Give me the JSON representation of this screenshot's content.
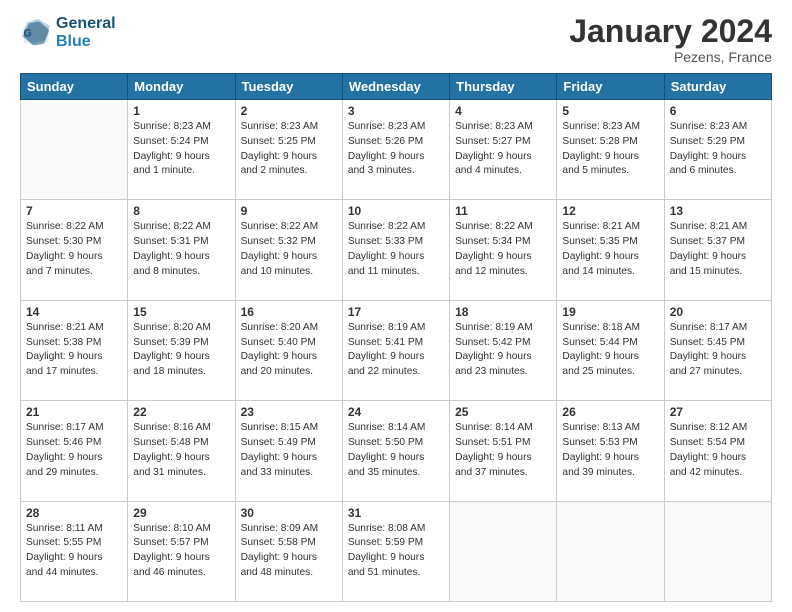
{
  "header": {
    "logo_line1": "General",
    "logo_line2": "Blue",
    "main_title": "January 2024",
    "subtitle": "Pezens, France"
  },
  "days_of_week": [
    "Sunday",
    "Monday",
    "Tuesday",
    "Wednesday",
    "Thursday",
    "Friday",
    "Saturday"
  ],
  "weeks": [
    [
      {
        "day": "",
        "info": ""
      },
      {
        "day": "1",
        "info": "Sunrise: 8:23 AM\nSunset: 5:24 PM\nDaylight: 9 hours\nand 1 minute."
      },
      {
        "day": "2",
        "info": "Sunrise: 8:23 AM\nSunset: 5:25 PM\nDaylight: 9 hours\nand 2 minutes."
      },
      {
        "day": "3",
        "info": "Sunrise: 8:23 AM\nSunset: 5:26 PM\nDaylight: 9 hours\nand 3 minutes."
      },
      {
        "day": "4",
        "info": "Sunrise: 8:23 AM\nSunset: 5:27 PM\nDaylight: 9 hours\nand 4 minutes."
      },
      {
        "day": "5",
        "info": "Sunrise: 8:23 AM\nSunset: 5:28 PM\nDaylight: 9 hours\nand 5 minutes."
      },
      {
        "day": "6",
        "info": "Sunrise: 8:23 AM\nSunset: 5:29 PM\nDaylight: 9 hours\nand 6 minutes."
      }
    ],
    [
      {
        "day": "7",
        "info": "Sunrise: 8:22 AM\nSunset: 5:30 PM\nDaylight: 9 hours\nand 7 minutes."
      },
      {
        "day": "8",
        "info": "Sunrise: 8:22 AM\nSunset: 5:31 PM\nDaylight: 9 hours\nand 8 minutes."
      },
      {
        "day": "9",
        "info": "Sunrise: 8:22 AM\nSunset: 5:32 PM\nDaylight: 9 hours\nand 10 minutes."
      },
      {
        "day": "10",
        "info": "Sunrise: 8:22 AM\nSunset: 5:33 PM\nDaylight: 9 hours\nand 11 minutes."
      },
      {
        "day": "11",
        "info": "Sunrise: 8:22 AM\nSunset: 5:34 PM\nDaylight: 9 hours\nand 12 minutes."
      },
      {
        "day": "12",
        "info": "Sunrise: 8:21 AM\nSunset: 5:35 PM\nDaylight: 9 hours\nand 14 minutes."
      },
      {
        "day": "13",
        "info": "Sunrise: 8:21 AM\nSunset: 5:37 PM\nDaylight: 9 hours\nand 15 minutes."
      }
    ],
    [
      {
        "day": "14",
        "info": "Sunrise: 8:21 AM\nSunset: 5:38 PM\nDaylight: 9 hours\nand 17 minutes."
      },
      {
        "day": "15",
        "info": "Sunrise: 8:20 AM\nSunset: 5:39 PM\nDaylight: 9 hours\nand 18 minutes."
      },
      {
        "day": "16",
        "info": "Sunrise: 8:20 AM\nSunset: 5:40 PM\nDaylight: 9 hours\nand 20 minutes."
      },
      {
        "day": "17",
        "info": "Sunrise: 8:19 AM\nSunset: 5:41 PM\nDaylight: 9 hours\nand 22 minutes."
      },
      {
        "day": "18",
        "info": "Sunrise: 8:19 AM\nSunset: 5:42 PM\nDaylight: 9 hours\nand 23 minutes."
      },
      {
        "day": "19",
        "info": "Sunrise: 8:18 AM\nSunset: 5:44 PM\nDaylight: 9 hours\nand 25 minutes."
      },
      {
        "day": "20",
        "info": "Sunrise: 8:17 AM\nSunset: 5:45 PM\nDaylight: 9 hours\nand 27 minutes."
      }
    ],
    [
      {
        "day": "21",
        "info": "Sunrise: 8:17 AM\nSunset: 5:46 PM\nDaylight: 9 hours\nand 29 minutes."
      },
      {
        "day": "22",
        "info": "Sunrise: 8:16 AM\nSunset: 5:48 PM\nDaylight: 9 hours\nand 31 minutes."
      },
      {
        "day": "23",
        "info": "Sunrise: 8:15 AM\nSunset: 5:49 PM\nDaylight: 9 hours\nand 33 minutes."
      },
      {
        "day": "24",
        "info": "Sunrise: 8:14 AM\nSunset: 5:50 PM\nDaylight: 9 hours\nand 35 minutes."
      },
      {
        "day": "25",
        "info": "Sunrise: 8:14 AM\nSunset: 5:51 PM\nDaylight: 9 hours\nand 37 minutes."
      },
      {
        "day": "26",
        "info": "Sunrise: 8:13 AM\nSunset: 5:53 PM\nDaylight: 9 hours\nand 39 minutes."
      },
      {
        "day": "27",
        "info": "Sunrise: 8:12 AM\nSunset: 5:54 PM\nDaylight: 9 hours\nand 42 minutes."
      }
    ],
    [
      {
        "day": "28",
        "info": "Sunrise: 8:11 AM\nSunset: 5:55 PM\nDaylight: 9 hours\nand 44 minutes."
      },
      {
        "day": "29",
        "info": "Sunrise: 8:10 AM\nSunset: 5:57 PM\nDaylight: 9 hours\nand 46 minutes."
      },
      {
        "day": "30",
        "info": "Sunrise: 8:09 AM\nSunset: 5:58 PM\nDaylight: 9 hours\nand 48 minutes."
      },
      {
        "day": "31",
        "info": "Sunrise: 8:08 AM\nSunset: 5:59 PM\nDaylight: 9 hours\nand 51 minutes."
      },
      {
        "day": "",
        "info": ""
      },
      {
        "day": "",
        "info": ""
      },
      {
        "day": "",
        "info": ""
      }
    ]
  ]
}
